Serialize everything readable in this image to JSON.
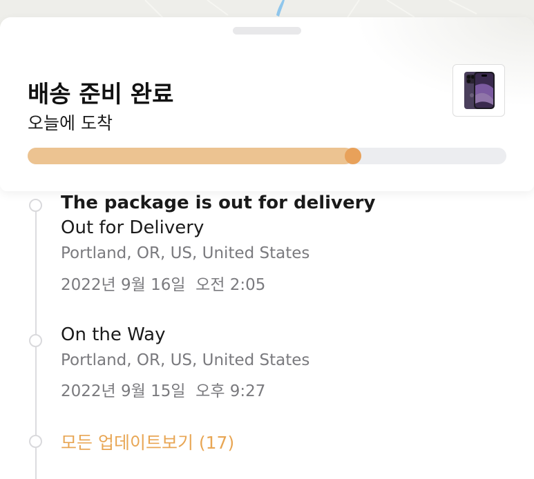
{
  "header": {
    "title": "배송 준비 완료",
    "subtitle": "오늘에 도착",
    "progress_fraction": 0.68
  },
  "product": {
    "icon": "iphone-product-icon"
  },
  "timeline": {
    "events": [
      {
        "headline": "The package is out for delivery",
        "status": "Out for Delivery",
        "location": "Portland, OR, US, United States",
        "datetime": "2022년 9월 16일  오전 2:05"
      },
      {
        "status": "On the Way",
        "location": "Portland, OR, US, United States",
        "datetime": "2022년 9월 15일  오후 9:27"
      }
    ],
    "view_all_label": "모든 업데이트보기 (17)"
  },
  "colors": {
    "progress_fill": "#ecc391",
    "progress_knob": "#e8a15a",
    "progress_track": "#ecedf0",
    "accent": "#e8a654"
  }
}
